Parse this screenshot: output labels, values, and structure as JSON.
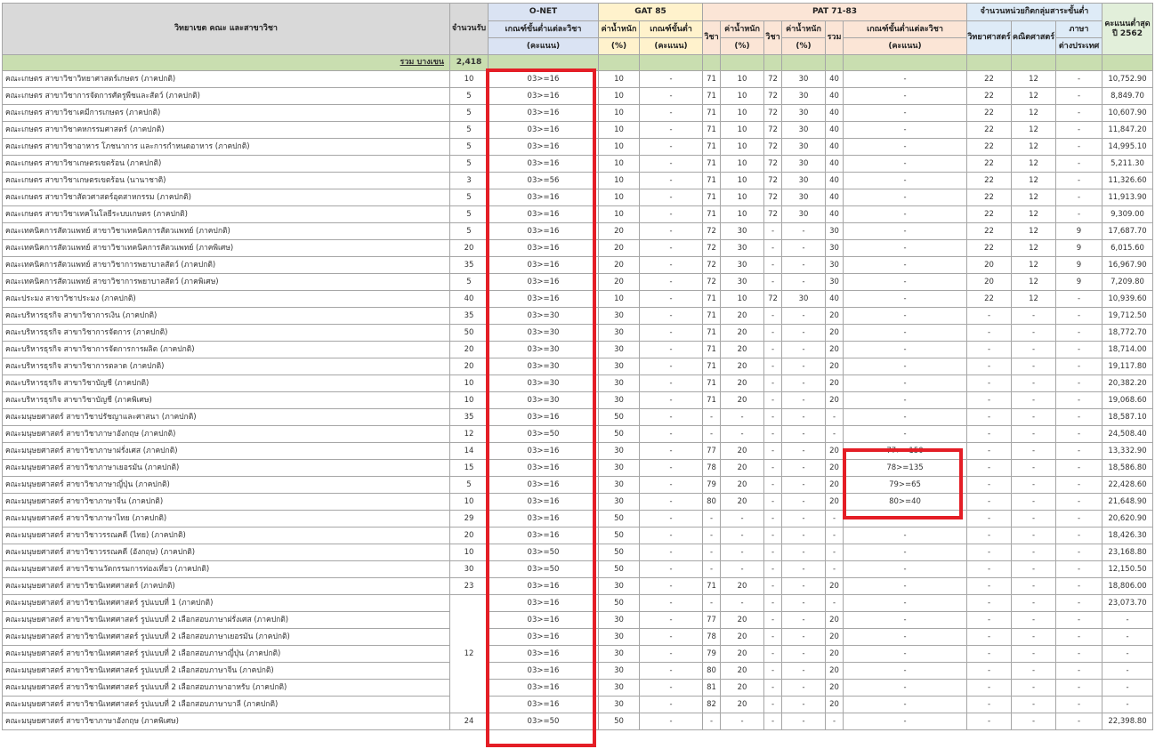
{
  "headers": {
    "program": "วิทยาเขต คณะ และสาขาวิชา",
    "quota": "จำนวนรับ",
    "onet": "O-NET",
    "onet_min_a": "เกณฑ์ขั้นต่ำแต่ละวิชา",
    "onet_min_b": "(คะแนน)",
    "gat": "GAT 85",
    "gat_weight_a": "ค่าน้ำหนัก",
    "gat_weight_b": "(%)",
    "gat_min_a": "เกณฑ์ขั้นต่ำ",
    "gat_min_b": "(คะแนน)",
    "pat": "PAT 71-83",
    "pat_subj1": "วิชา",
    "pat_weight1_a": "ค่าน้ำหนัก",
    "pat_weight1_b": "(%)",
    "pat_subj2": "วิชา",
    "pat_weight2_a": "ค่าน้ำหนัก",
    "pat_weight2_b": "(%)",
    "pat_total": "รวม",
    "pat_min_a": "เกณฑ์ขั้นต่ำแต่ละวิชา",
    "pat_min_b": "(คะแนน)",
    "core": "จำนวนหน่วยกิตกลุ่มสาระขั้นต่ำ",
    "core_sci": "วิทยาศาสตร์",
    "core_math": "คณิตศาสตร์",
    "core_lang_a": "ภาษา",
    "core_lang_b": "ต่างประเทศ",
    "max_a": "คะแนนต่ำสุด",
    "max_b": "ปี 2562"
  },
  "total_row": {
    "label": "รวม บางเขน",
    "quota": "2,418"
  },
  "rows": [
    {
      "name": "คณะเกษตร สาขาวิชาวิทยาศาสตร์เกษตร (ภาคปกติ)",
      "quota": "10",
      "onet": "03>=16",
      "gat_w": "10",
      "gat_min": "-",
      "p1": "71",
      "w1": "10",
      "p2": "72",
      "w2": "30",
      "sum": "40",
      "pmin": "-",
      "sci": "22",
      "math": "12",
      "lang": "-",
      "score": "10,752.90"
    },
    {
      "name": "คณะเกษตร สาขาวิชาการจัดการศัตรูพืชและสัตว์ (ภาคปกติ)",
      "quota": "5",
      "onet": "03>=16",
      "gat_w": "10",
      "gat_min": "-",
      "p1": "71",
      "w1": "10",
      "p2": "72",
      "w2": "30",
      "sum": "40",
      "pmin": "-",
      "sci": "22",
      "math": "12",
      "lang": "-",
      "score": "8,849.70"
    },
    {
      "name": "คณะเกษตร สาขาวิชาเคมีการเกษตร (ภาคปกติ)",
      "quota": "5",
      "onet": "03>=16",
      "gat_w": "10",
      "gat_min": "-",
      "p1": "71",
      "w1": "10",
      "p2": "72",
      "w2": "30",
      "sum": "40",
      "pmin": "-",
      "sci": "22",
      "math": "12",
      "lang": "-",
      "score": "10,607.90"
    },
    {
      "name": "คณะเกษตร สาขาวิชาคหกรรมศาสตร์ (ภาคปกติ)",
      "quota": "5",
      "onet": "03>=16",
      "gat_w": "10",
      "gat_min": "-",
      "p1": "71",
      "w1": "10",
      "p2": "72",
      "w2": "30",
      "sum": "40",
      "pmin": "-",
      "sci": "22",
      "math": "12",
      "lang": "-",
      "score": "11,847.20"
    },
    {
      "name": "คณะเกษตร สาขาวิชาอาหาร โภชนาการ และการกำหนดอาหาร (ภาคปกติ)",
      "quota": "5",
      "onet": "03>=16",
      "gat_w": "10",
      "gat_min": "-",
      "p1": "71",
      "w1": "10",
      "p2": "72",
      "w2": "30",
      "sum": "40",
      "pmin": "-",
      "sci": "22",
      "math": "12",
      "lang": "-",
      "score": "14,995.10"
    },
    {
      "name": "คณะเกษตร สาขาวิชาเกษตรเขตร้อน (ภาคปกติ)",
      "quota": "5",
      "onet": "03>=16",
      "gat_w": "10",
      "gat_min": "-",
      "p1": "71",
      "w1": "10",
      "p2": "72",
      "w2": "30",
      "sum": "40",
      "pmin": "-",
      "sci": "22",
      "math": "12",
      "lang": "-",
      "score": "5,211.30"
    },
    {
      "name": "คณะเกษตร สาขาวิชาเกษตรเขตร้อน (นานาชาติ)",
      "quota": "3",
      "onet": "03>=56",
      "gat_w": "10",
      "gat_min": "-",
      "p1": "71",
      "w1": "10",
      "p2": "72",
      "w2": "30",
      "sum": "40",
      "pmin": "-",
      "sci": "22",
      "math": "12",
      "lang": "-",
      "score": "11,326.60"
    },
    {
      "name": "คณะเกษตร สาขาวิชาสัตวศาสตร์อุตสาหกรรม (ภาคปกติ)",
      "quota": "5",
      "onet": "03>=16",
      "gat_w": "10",
      "gat_min": "-",
      "p1": "71",
      "w1": "10",
      "p2": "72",
      "w2": "30",
      "sum": "40",
      "pmin": "-",
      "sci": "22",
      "math": "12",
      "lang": "-",
      "score": "11,913.90"
    },
    {
      "name": "คณะเกษตร สาขาวิชาเทคโนโลยีระบบเกษตร (ภาคปกติ)",
      "quota": "5",
      "onet": "03>=16",
      "gat_w": "10",
      "gat_min": "-",
      "p1": "71",
      "w1": "10",
      "p2": "72",
      "w2": "30",
      "sum": "40",
      "pmin": "-",
      "sci": "22",
      "math": "12",
      "lang": "-",
      "score": "9,309.00"
    },
    {
      "name": "คณะเทคนิคการสัตวแพทย์ สาขาวิชาเทคนิคการสัตวแพทย์ (ภาคปกติ)",
      "quota": "5",
      "onet": "03>=16",
      "gat_w": "20",
      "gat_min": "-",
      "p1": "72",
      "w1": "30",
      "p2": "-",
      "w2": "-",
      "sum": "30",
      "pmin": "-",
      "sci": "22",
      "math": "12",
      "lang": "9",
      "score": "17,687.70"
    },
    {
      "name": "คณะเทคนิคการสัตวแพทย์ สาขาวิชาเทคนิคการสัตวแพทย์ (ภาคพิเศษ)",
      "quota": "20",
      "onet": "03>=16",
      "gat_w": "20",
      "gat_min": "-",
      "p1": "72",
      "w1": "30",
      "p2": "-",
      "w2": "-",
      "sum": "30",
      "pmin": "-",
      "sci": "22",
      "math": "12",
      "lang": "9",
      "score": "6,015.60"
    },
    {
      "name": "คณะเทคนิคการสัตวแพทย์ สาขาวิชาการพยาบาลสัตว์ (ภาคปกติ)",
      "quota": "35",
      "onet": "03>=16",
      "gat_w": "20",
      "gat_min": "-",
      "p1": "72",
      "w1": "30",
      "p2": "-",
      "w2": "-",
      "sum": "30",
      "pmin": "-",
      "sci": "20",
      "math": "12",
      "lang": "9",
      "score": "16,967.90"
    },
    {
      "name": "คณะเทคนิคการสัตวแพทย์ สาขาวิชาการพยาบาลสัตว์ (ภาคพิเศษ)",
      "quota": "5",
      "onet": "03>=16",
      "gat_w": "20",
      "gat_min": "-",
      "p1": "72",
      "w1": "30",
      "p2": "-",
      "w2": "-",
      "sum": "30",
      "pmin": "-",
      "sci": "20",
      "math": "12",
      "lang": "9",
      "score": "7,209.80"
    },
    {
      "name": "คณะประมง สาขาวิชาประมง (ภาคปกติ)",
      "quota": "40",
      "onet": "03>=16",
      "gat_w": "10",
      "gat_min": "-",
      "p1": "71",
      "w1": "10",
      "p2": "72",
      "w2": "30",
      "sum": "40",
      "pmin": "-",
      "sci": "22",
      "math": "12",
      "lang": "-",
      "score": "10,939.60"
    },
    {
      "name": "คณะบริหารธุรกิจ สาขาวิชาการเงิน (ภาคปกติ)",
      "quota": "35",
      "onet": "03>=30",
      "gat_w": "30",
      "gat_min": "-",
      "p1": "71",
      "w1": "20",
      "p2": "-",
      "w2": "-",
      "sum": "20",
      "pmin": "-",
      "sci": "-",
      "math": "-",
      "lang": "-",
      "score": "19,712.50"
    },
    {
      "name": "คณะบริหารธุรกิจ สาขาวิชาการจัดการ (ภาคปกติ)",
      "quota": "50",
      "onet": "03>=30",
      "gat_w": "30",
      "gat_min": "-",
      "p1": "71",
      "w1": "20",
      "p2": "-",
      "w2": "-",
      "sum": "20",
      "pmin": "-",
      "sci": "-",
      "math": "-",
      "lang": "-",
      "score": "18,772.70"
    },
    {
      "name": "คณะบริหารธุรกิจ สาขาวิชาการจัดการการผลิต (ภาคปกติ)",
      "quota": "20",
      "onet": "03>=30",
      "gat_w": "30",
      "gat_min": "-",
      "p1": "71",
      "w1": "20",
      "p2": "-",
      "w2": "-",
      "sum": "20",
      "pmin": "-",
      "sci": "-",
      "math": "-",
      "lang": "-",
      "score": "18,714.00"
    },
    {
      "name": "คณะบริหารธุรกิจ สาขาวิชาการตลาด (ภาคปกติ)",
      "quota": "20",
      "onet": "03>=30",
      "gat_w": "30",
      "gat_min": "-",
      "p1": "71",
      "w1": "20",
      "p2": "-",
      "w2": "-",
      "sum": "20",
      "pmin": "-",
      "sci": "-",
      "math": "-",
      "lang": "-",
      "score": "19,117.80"
    },
    {
      "name": "คณะบริหารธุรกิจ สาขาวิชาบัญชี (ภาคปกติ)",
      "quota": "10",
      "onet": "03>=30",
      "gat_w": "30",
      "gat_min": "-",
      "p1": "71",
      "w1": "20",
      "p2": "-",
      "w2": "-",
      "sum": "20",
      "pmin": "-",
      "sci": "-",
      "math": "-",
      "lang": "-",
      "score": "20,382.20"
    },
    {
      "name": "คณะบริหารธุรกิจ สาขาวิชาบัญชี (ภาคพิเศษ)",
      "quota": "10",
      "onet": "03>=30",
      "gat_w": "30",
      "gat_min": "-",
      "p1": "71",
      "w1": "20",
      "p2": "-",
      "w2": "-",
      "sum": "20",
      "pmin": "-",
      "sci": "-",
      "math": "-",
      "lang": "-",
      "score": "19,068.60"
    },
    {
      "name": "คณะมนุษยศาสตร์ สาขาวิชาปรัชญาและศาสนา (ภาคปกติ)",
      "quota": "35",
      "onet": "03>=16",
      "gat_w": "50",
      "gat_min": "-",
      "p1": "-",
      "w1": "-",
      "p2": "-",
      "w2": "-",
      "sum": "-",
      "pmin": "-",
      "sci": "-",
      "math": "-",
      "lang": "-",
      "score": "18,587.10"
    },
    {
      "name": "คณะมนุษยศาสตร์ สาขาวิชาภาษาอังกฤษ (ภาคปกติ)",
      "quota": "12",
      "onet": "03>=50",
      "gat_w": "50",
      "gat_min": "-",
      "p1": "-",
      "w1": "-",
      "p2": "-",
      "w2": "-",
      "sum": "-",
      "pmin": "-",
      "sci": "-",
      "math": "-",
      "lang": "-",
      "score": "24,508.40"
    },
    {
      "name": "คณะมนุษยศาสตร์ สาขาวิชาภาษาฝรั่งเศส (ภาคปกติ)",
      "quota": "14",
      "onet": "03>=16",
      "gat_w": "30",
      "gat_min": "-",
      "p1": "77",
      "w1": "20",
      "p2": "-",
      "w2": "-",
      "sum": "20",
      "pmin": "77>=150",
      "sci": "-",
      "math": "-",
      "lang": "-",
      "score": "13,332.90"
    },
    {
      "name": "คณะมนุษยศาสตร์ สาขาวิชาภาษาเยอรมัน (ภาคปกติ)",
      "quota": "15",
      "onet": "03>=16",
      "gat_w": "30",
      "gat_min": "-",
      "p1": "78",
      "w1": "20",
      "p2": "-",
      "w2": "-",
      "sum": "20",
      "pmin": "78>=135",
      "sci": "-",
      "math": "-",
      "lang": "-",
      "score": "18,586.80"
    },
    {
      "name": "คณะมนุษยศาสตร์ สาขาวิชาภาษาญี่ปุ่น (ภาคปกติ)",
      "quota": "5",
      "onet": "03>=16",
      "gat_w": "30",
      "gat_min": "-",
      "p1": "79",
      "w1": "20",
      "p2": "-",
      "w2": "-",
      "sum": "20",
      "pmin": "79>=65",
      "sci": "-",
      "math": "-",
      "lang": "-",
      "score": "22,428.60"
    },
    {
      "name": "คณะมนุษยศาสตร์ สาขาวิชาภาษาจีน (ภาคปกติ)",
      "quota": "10",
      "onet": "03>=16",
      "gat_w": "30",
      "gat_min": "-",
      "p1": "80",
      "w1": "20",
      "p2": "-",
      "w2": "-",
      "sum": "20",
      "pmin": "80>=40",
      "sci": "-",
      "math": "-",
      "lang": "-",
      "score": "21,648.90"
    },
    {
      "name": "คณะมนุษยศาสตร์ สาขาวิชาภาษาไทย (ภาคปกติ)",
      "quota": "29",
      "onet": "03>=16",
      "gat_w": "50",
      "gat_min": "-",
      "p1": "-",
      "w1": "-",
      "p2": "-",
      "w2": "-",
      "sum": "-",
      "pmin": "-",
      "sci": "-",
      "math": "-",
      "lang": "-",
      "score": "20,620.90"
    },
    {
      "name": "คณะมนุษยศาสตร์ สาขาวิชาวรรณคดี (ไทย) (ภาคปกติ)",
      "quota": "20",
      "onet": "03>=16",
      "gat_w": "50",
      "gat_min": "-",
      "p1": "-",
      "w1": "-",
      "p2": "-",
      "w2": "-",
      "sum": "-",
      "pmin": "-",
      "sci": "-",
      "math": "-",
      "lang": "-",
      "score": "18,426.30"
    },
    {
      "name": "คณะมนุษยศาสตร์ สาขาวิชาวรรณคดี (อังกฤษ) (ภาคปกติ)",
      "quota": "10",
      "onet": "03>=50",
      "gat_w": "50",
      "gat_min": "-",
      "p1": "-",
      "w1": "-",
      "p2": "-",
      "w2": "-",
      "sum": "-",
      "pmin": "-",
      "sci": "-",
      "math": "-",
      "lang": "-",
      "score": "23,168.80"
    },
    {
      "name": "คณะมนุษยศาสตร์ สาขาวิชานวัตกรรมการท่องเที่ยว (ภาคปกติ)",
      "quota": "30",
      "onet": "03>=50",
      "gat_w": "50",
      "gat_min": "-",
      "p1": "-",
      "w1": "-",
      "p2": "-",
      "w2": "-",
      "sum": "-",
      "pmin": "-",
      "sci": "-",
      "math": "-",
      "lang": "-",
      "score": "12,150.50"
    },
    {
      "name": "คณะมนุษยศาสตร์ สาขาวิชานิเทศศาสตร์ (ภาคปกติ)",
      "quota": "23",
      "onet": "03>=16",
      "gat_w": "30",
      "gat_min": "-",
      "p1": "71",
      "w1": "20",
      "p2": "-",
      "w2": "-",
      "sum": "20",
      "pmin": "-",
      "sci": "-",
      "math": "-",
      "lang": "-",
      "score": "18,806.00"
    },
    {
      "name": "คณะมนุษยศาสตร์ สาขาวิชานิเทศศาสตร์ รูปแบบที่ 1 (ภาคปกติ)",
      "quota": "",
      "onet": "03>=16",
      "gat_w": "50",
      "gat_min": "-",
      "p1": "-",
      "w1": "-",
      "p2": "-",
      "w2": "-",
      "sum": "-",
      "pmin": "-",
      "sci": "-",
      "math": "-",
      "lang": "-",
      "score": "23,073.70"
    },
    {
      "name": "คณะมนุษยศาสตร์ สาขาวิชานิเทศศาสตร์ รูปแบบที่ 2 เลือกสอบภาษาฝรั่งเศส (ภาคปกติ)",
      "quota": "",
      "onet": "03>=16",
      "gat_w": "30",
      "gat_min": "-",
      "p1": "77",
      "w1": "20",
      "p2": "-",
      "w2": "-",
      "sum": "20",
      "pmin": "-",
      "sci": "-",
      "math": "-",
      "lang": "-",
      "score": "-"
    },
    {
      "name": "คณะมนุษยศาสตร์ สาขาวิชานิเทศศาสตร์ รูปแบบที่ 2 เลือกสอบภาษาเยอรมัน (ภาคปกติ)",
      "quota": "",
      "onet": "03>=16",
      "gat_w": "30",
      "gat_min": "-",
      "p1": "78",
      "w1": "20",
      "p2": "-",
      "w2": "-",
      "sum": "20",
      "pmin": "-",
      "sci": "-",
      "math": "-",
      "lang": "-",
      "score": "-"
    },
    {
      "name": "คณะมนุษยศาสตร์ สาขาวิชานิเทศศาสตร์ รูปแบบที่ 2 เลือกสอบภาษาญี่ปุ่น (ภาคปกติ)",
      "quota": "12",
      "onet": "03>=16",
      "gat_w": "30",
      "gat_min": "-",
      "p1": "79",
      "w1": "20",
      "p2": "-",
      "w2": "-",
      "sum": "20",
      "pmin": "-",
      "sci": "-",
      "math": "-",
      "lang": "-",
      "score": "-"
    },
    {
      "name": "คณะมนุษยศาสตร์ สาขาวิชานิเทศศาสตร์ รูปแบบที่ 2 เลือกสอบภาษาจีน (ภาคปกติ)",
      "quota": "",
      "onet": "03>=16",
      "gat_w": "30",
      "gat_min": "-",
      "p1": "80",
      "w1": "20",
      "p2": "-",
      "w2": "-",
      "sum": "20",
      "pmin": "-",
      "sci": "-",
      "math": "-",
      "lang": "-",
      "score": "-"
    },
    {
      "name": "คณะมนุษยศาสตร์ สาขาวิชานิเทศศาสตร์ รูปแบบที่ 2 เลือกสอบภาษาอาหรับ (ภาคปกติ)",
      "quota": "",
      "onet": "03>=16",
      "gat_w": "30",
      "gat_min": "-",
      "p1": "81",
      "w1": "20",
      "p2": "-",
      "w2": "-",
      "sum": "20",
      "pmin": "-",
      "sci": "-",
      "math": "-",
      "lang": "-",
      "score": "-"
    },
    {
      "name": "คณะมนุษยศาสตร์ สาขาวิชานิเทศศาสตร์ รูปแบบที่ 2 เลือกสอบภาษาบาลี (ภาคปกติ)",
      "quota": "",
      "onet": "03>=16",
      "gat_w": "30",
      "gat_min": "-",
      "p1": "82",
      "w1": "20",
      "p2": "-",
      "w2": "-",
      "sum": "20",
      "pmin": "-",
      "sci": "-",
      "math": "-",
      "lang": "-",
      "score": "-"
    },
    {
      "name": "คณะมนุษยศาสตร์ สาขาวิชาภาษาอังกฤษ (ภาคพิเศษ)",
      "quota": "24",
      "onet": "03>=50",
      "gat_w": "50",
      "gat_min": "-",
      "p1": "-",
      "w1": "-",
      "p2": "-",
      "w2": "-",
      "sum": "-",
      "pmin": "-",
      "sci": "-",
      "math": "-",
      "lang": "-",
      "score": "22,398.80"
    }
  ],
  "highlight_color": "#e41e26"
}
